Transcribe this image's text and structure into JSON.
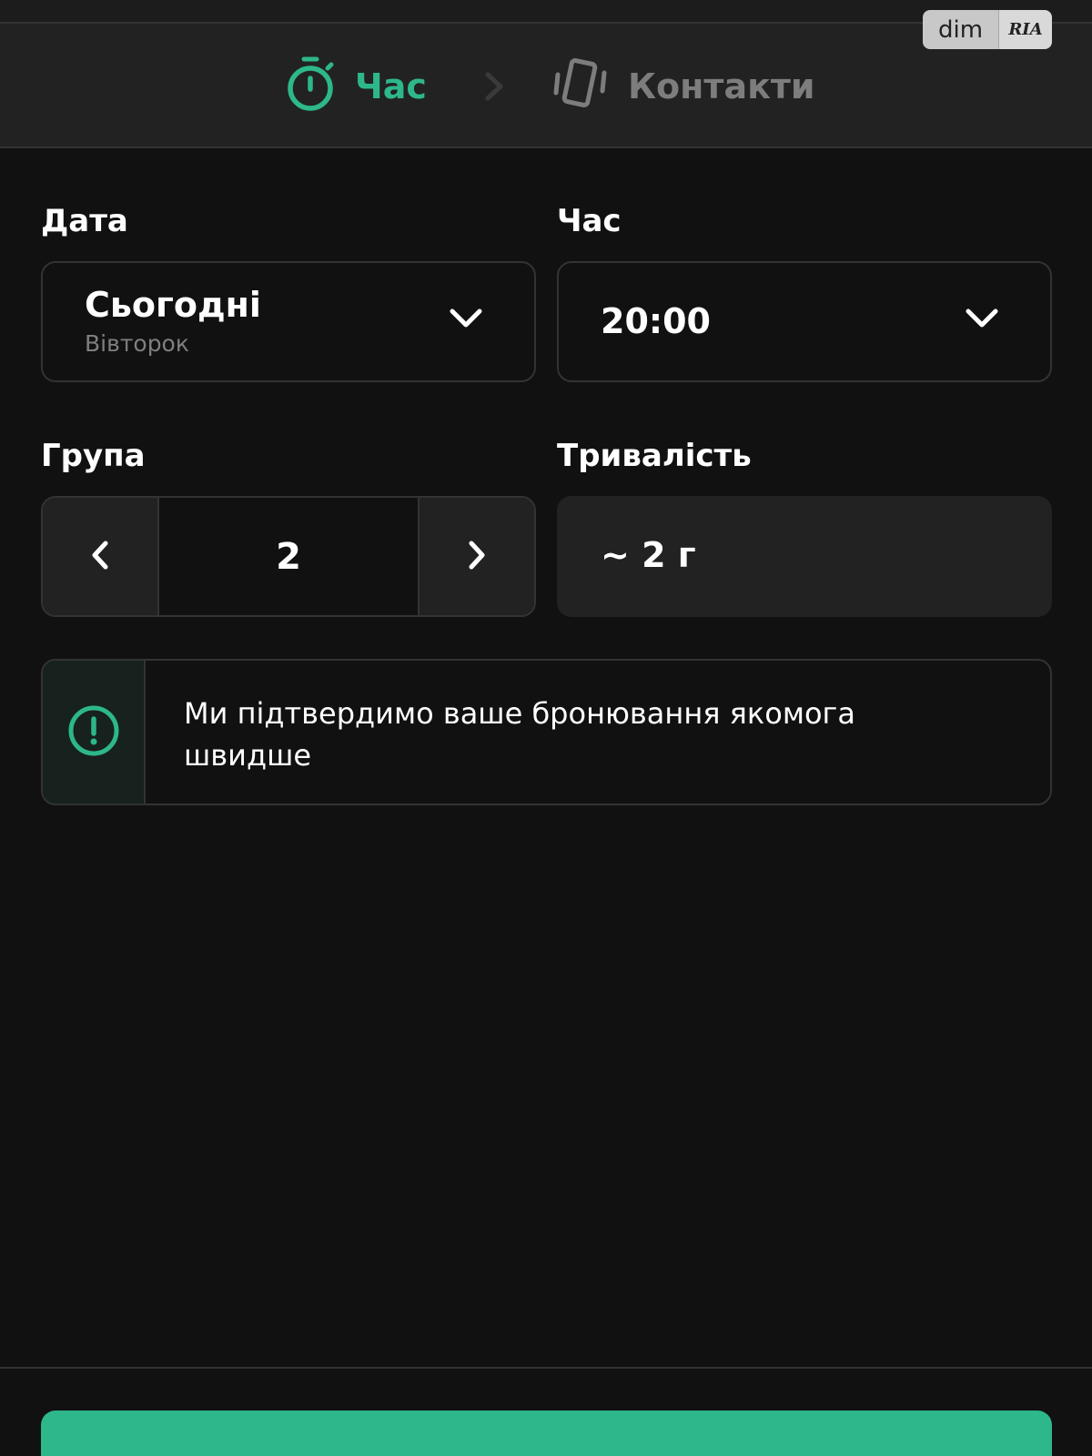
{
  "colors": {
    "accent": "#2db78a",
    "background": "#111111",
    "surface": "#222222",
    "border": "#333333",
    "muted_text": "#7f7f7f"
  },
  "watermark": {
    "left": "dim",
    "right": "RIA"
  },
  "stepper": {
    "steps": [
      {
        "label": "Час",
        "icon": "stopwatch-icon",
        "active": true
      },
      {
        "label": "Контакти",
        "icon": "phone-vibrate-icon",
        "active": false
      }
    ],
    "separator_icon": "chevron-right-icon"
  },
  "date": {
    "label": "Дата",
    "value": "Сьогодні",
    "sub": "Вівторок",
    "icon": "chevron-down-icon"
  },
  "time": {
    "label": "Час",
    "value": "20:00",
    "icon": "chevron-down-icon"
  },
  "group": {
    "label": "Група",
    "value": "2",
    "decrement_icon": "chevron-left-icon",
    "increment_icon": "chevron-right-icon"
  },
  "duration": {
    "label": "Тривалість",
    "value": "~ 2 г"
  },
  "notice": {
    "icon": "alert-circle-icon",
    "text": "Ми підтвердимо ваше бронювання якомога швидше"
  }
}
